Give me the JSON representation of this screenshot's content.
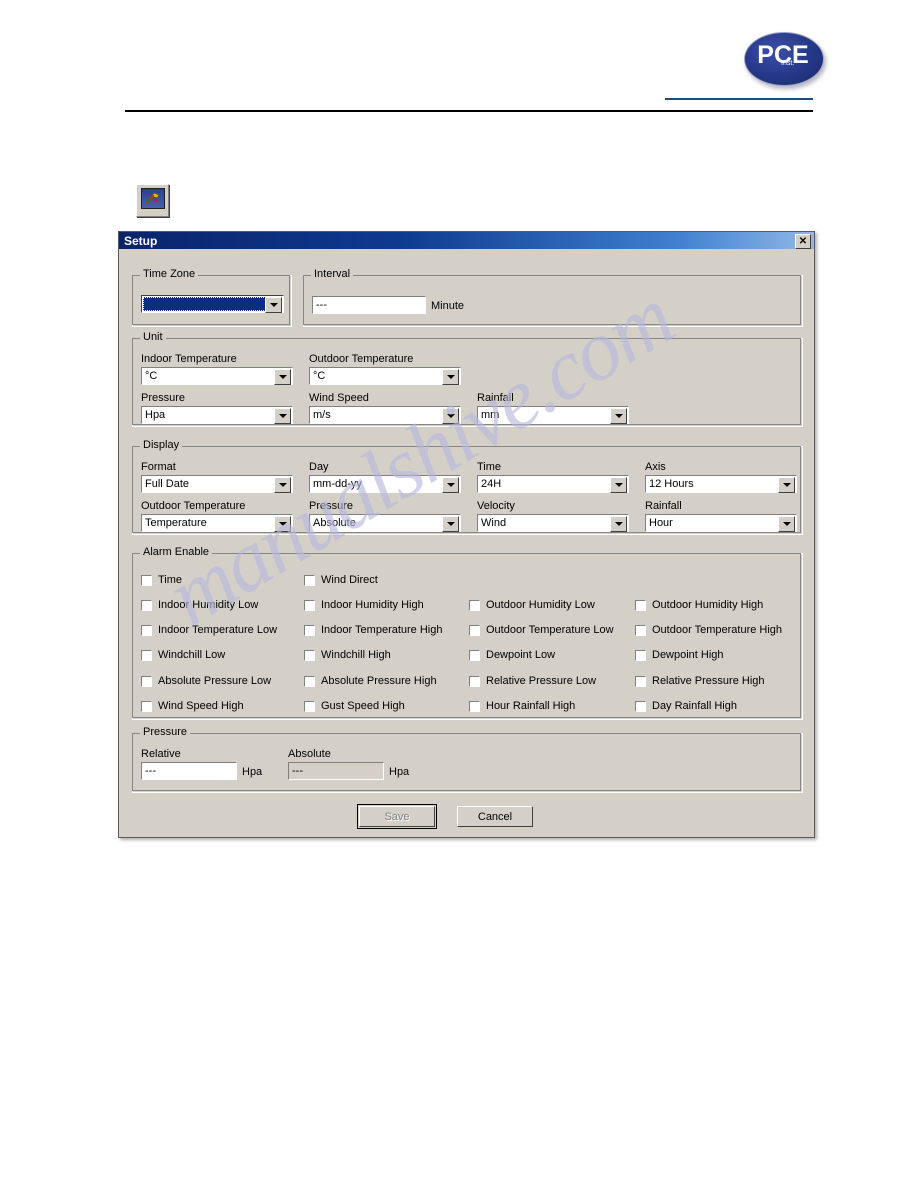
{
  "page": {
    "watermark": "manualshive.com",
    "logo": {
      "text": "PCE",
      "sub": "Inst."
    }
  },
  "toolbar": {
    "icon_name": "setup-toolbar-icon"
  },
  "dialog": {
    "title": "Setup",
    "close_label": "✕",
    "time_zone": {
      "legend": "Time Zone",
      "value": ""
    },
    "interval": {
      "legend": "Interval",
      "value": "---",
      "unit": "Minute"
    },
    "unit": {
      "legend": "Unit",
      "fields": [
        {
          "label": "Indoor Temperature",
          "value": "°C"
        },
        {
          "label": "Outdoor Temperature",
          "value": "°C"
        },
        {
          "label": "Pressure",
          "value": "Hpa"
        },
        {
          "label": "Wind Speed",
          "value": "m/s"
        },
        {
          "label": "Rainfall",
          "value": "mm"
        }
      ]
    },
    "display": {
      "legend": "Display",
      "fields": [
        {
          "label": "Format",
          "value": "Full Date"
        },
        {
          "label": "Day",
          "value": "mm-dd-yy"
        },
        {
          "label": "Time",
          "value": "24H"
        },
        {
          "label": "Axis",
          "value": "12 Hours"
        },
        {
          "label": "Outdoor Temperature",
          "value": "Temperature"
        },
        {
          "label": "Pressure",
          "value": "Absolute"
        },
        {
          "label": "Velocity",
          "value": "Wind"
        },
        {
          "label": "Rainfall",
          "value": "Hour"
        }
      ]
    },
    "alarm": {
      "legend": "Alarm Enable",
      "items": [
        {
          "label": "Time",
          "checked": false
        },
        {
          "label": "Wind Direct",
          "checked": false
        },
        {
          "label": "Indoor Humidity Low",
          "checked": false
        },
        {
          "label": "Indoor Humidity High",
          "checked": false
        },
        {
          "label": "Outdoor Humidity Low",
          "checked": false
        },
        {
          "label": "Outdoor Humidity High",
          "checked": false
        },
        {
          "label": "Indoor Temperature Low",
          "checked": false
        },
        {
          "label": "Indoor Temperature High",
          "checked": false
        },
        {
          "label": "Outdoor Temperature Low",
          "checked": false
        },
        {
          "label": "Outdoor Temperature High",
          "checked": false
        },
        {
          "label": "Windchill Low",
          "checked": false
        },
        {
          "label": "Windchill High",
          "checked": false
        },
        {
          "label": "Dewpoint Low",
          "checked": false
        },
        {
          "label": "Dewpoint High",
          "checked": false
        },
        {
          "label": "Absolute Pressure Low",
          "checked": false
        },
        {
          "label": "Absolute Pressure High",
          "checked": false
        },
        {
          "label": "Relative Pressure Low",
          "checked": false
        },
        {
          "label": "Relative Pressure High",
          "checked": false
        },
        {
          "label": "Wind Speed High",
          "checked": false
        },
        {
          "label": "Gust Speed High",
          "checked": false
        },
        {
          "label": "Hour Rainfall High",
          "checked": false
        },
        {
          "label": "Day Rainfall High",
          "checked": false
        }
      ]
    },
    "pressure": {
      "legend": "Pressure",
      "relative": {
        "label": "Relative",
        "value": "---",
        "unit": "Hpa"
      },
      "absolute": {
        "label": "Absolute",
        "value": "---",
        "unit": "Hpa"
      }
    },
    "buttons": {
      "save": "Save",
      "cancel": "Cancel"
    }
  },
  "colors": {
    "titlebar_start": "#0a246a",
    "titlebar_end": "#8fb8e8",
    "dialog_face": "#d4d0c8",
    "selection_blue": "#0a2d82",
    "rule_blue": "#1b4f79",
    "watermark": "#b6b7dd"
  }
}
